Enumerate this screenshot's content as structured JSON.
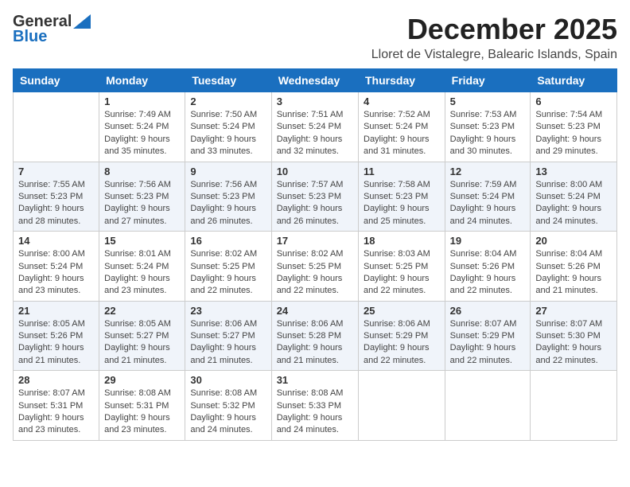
{
  "logo": {
    "general": "General",
    "blue": "Blue"
  },
  "title": "December 2025",
  "location": "Lloret de Vistalegre, Balearic Islands, Spain",
  "days_of_week": [
    "Sunday",
    "Monday",
    "Tuesday",
    "Wednesday",
    "Thursday",
    "Friday",
    "Saturday"
  ],
  "weeks": [
    [
      {
        "day": "",
        "sunrise": "",
        "sunset": "",
        "daylight": ""
      },
      {
        "day": "1",
        "sunrise": "Sunrise: 7:49 AM",
        "sunset": "Sunset: 5:24 PM",
        "daylight": "Daylight: 9 hours and 35 minutes."
      },
      {
        "day": "2",
        "sunrise": "Sunrise: 7:50 AM",
        "sunset": "Sunset: 5:24 PM",
        "daylight": "Daylight: 9 hours and 33 minutes."
      },
      {
        "day": "3",
        "sunrise": "Sunrise: 7:51 AM",
        "sunset": "Sunset: 5:24 PM",
        "daylight": "Daylight: 9 hours and 32 minutes."
      },
      {
        "day": "4",
        "sunrise": "Sunrise: 7:52 AM",
        "sunset": "Sunset: 5:24 PM",
        "daylight": "Daylight: 9 hours and 31 minutes."
      },
      {
        "day": "5",
        "sunrise": "Sunrise: 7:53 AM",
        "sunset": "Sunset: 5:23 PM",
        "daylight": "Daylight: 9 hours and 30 minutes."
      },
      {
        "day": "6",
        "sunrise": "Sunrise: 7:54 AM",
        "sunset": "Sunset: 5:23 PM",
        "daylight": "Daylight: 9 hours and 29 minutes."
      }
    ],
    [
      {
        "day": "7",
        "sunrise": "Sunrise: 7:55 AM",
        "sunset": "Sunset: 5:23 PM",
        "daylight": "Daylight: 9 hours and 28 minutes."
      },
      {
        "day": "8",
        "sunrise": "Sunrise: 7:56 AM",
        "sunset": "Sunset: 5:23 PM",
        "daylight": "Daylight: 9 hours and 27 minutes."
      },
      {
        "day": "9",
        "sunrise": "Sunrise: 7:56 AM",
        "sunset": "Sunset: 5:23 PM",
        "daylight": "Daylight: 9 hours and 26 minutes."
      },
      {
        "day": "10",
        "sunrise": "Sunrise: 7:57 AM",
        "sunset": "Sunset: 5:23 PM",
        "daylight": "Daylight: 9 hours and 26 minutes."
      },
      {
        "day": "11",
        "sunrise": "Sunrise: 7:58 AM",
        "sunset": "Sunset: 5:23 PM",
        "daylight": "Daylight: 9 hours and 25 minutes."
      },
      {
        "day": "12",
        "sunrise": "Sunrise: 7:59 AM",
        "sunset": "Sunset: 5:24 PM",
        "daylight": "Daylight: 9 hours and 24 minutes."
      },
      {
        "day": "13",
        "sunrise": "Sunrise: 8:00 AM",
        "sunset": "Sunset: 5:24 PM",
        "daylight": "Daylight: 9 hours and 24 minutes."
      }
    ],
    [
      {
        "day": "14",
        "sunrise": "Sunrise: 8:00 AM",
        "sunset": "Sunset: 5:24 PM",
        "daylight": "Daylight: 9 hours and 23 minutes."
      },
      {
        "day": "15",
        "sunrise": "Sunrise: 8:01 AM",
        "sunset": "Sunset: 5:24 PM",
        "daylight": "Daylight: 9 hours and 23 minutes."
      },
      {
        "day": "16",
        "sunrise": "Sunrise: 8:02 AM",
        "sunset": "Sunset: 5:25 PM",
        "daylight": "Daylight: 9 hours and 22 minutes."
      },
      {
        "day": "17",
        "sunrise": "Sunrise: 8:02 AM",
        "sunset": "Sunset: 5:25 PM",
        "daylight": "Daylight: 9 hours and 22 minutes."
      },
      {
        "day": "18",
        "sunrise": "Sunrise: 8:03 AM",
        "sunset": "Sunset: 5:25 PM",
        "daylight": "Daylight: 9 hours and 22 minutes."
      },
      {
        "day": "19",
        "sunrise": "Sunrise: 8:04 AM",
        "sunset": "Sunset: 5:26 PM",
        "daylight": "Daylight: 9 hours and 22 minutes."
      },
      {
        "day": "20",
        "sunrise": "Sunrise: 8:04 AM",
        "sunset": "Sunset: 5:26 PM",
        "daylight": "Daylight: 9 hours and 21 minutes."
      }
    ],
    [
      {
        "day": "21",
        "sunrise": "Sunrise: 8:05 AM",
        "sunset": "Sunset: 5:26 PM",
        "daylight": "Daylight: 9 hours and 21 minutes."
      },
      {
        "day": "22",
        "sunrise": "Sunrise: 8:05 AM",
        "sunset": "Sunset: 5:27 PM",
        "daylight": "Daylight: 9 hours and 21 minutes."
      },
      {
        "day": "23",
        "sunrise": "Sunrise: 8:06 AM",
        "sunset": "Sunset: 5:27 PM",
        "daylight": "Daylight: 9 hours and 21 minutes."
      },
      {
        "day": "24",
        "sunrise": "Sunrise: 8:06 AM",
        "sunset": "Sunset: 5:28 PM",
        "daylight": "Daylight: 9 hours and 21 minutes."
      },
      {
        "day": "25",
        "sunrise": "Sunrise: 8:06 AM",
        "sunset": "Sunset: 5:29 PM",
        "daylight": "Daylight: 9 hours and 22 minutes."
      },
      {
        "day": "26",
        "sunrise": "Sunrise: 8:07 AM",
        "sunset": "Sunset: 5:29 PM",
        "daylight": "Daylight: 9 hours and 22 minutes."
      },
      {
        "day": "27",
        "sunrise": "Sunrise: 8:07 AM",
        "sunset": "Sunset: 5:30 PM",
        "daylight": "Daylight: 9 hours and 22 minutes."
      }
    ],
    [
      {
        "day": "28",
        "sunrise": "Sunrise: 8:07 AM",
        "sunset": "Sunset: 5:31 PM",
        "daylight": "Daylight: 9 hours and 23 minutes."
      },
      {
        "day": "29",
        "sunrise": "Sunrise: 8:08 AM",
        "sunset": "Sunset: 5:31 PM",
        "daylight": "Daylight: 9 hours and 23 minutes."
      },
      {
        "day": "30",
        "sunrise": "Sunrise: 8:08 AM",
        "sunset": "Sunset: 5:32 PM",
        "daylight": "Daylight: 9 hours and 24 minutes."
      },
      {
        "day": "31",
        "sunrise": "Sunrise: 8:08 AM",
        "sunset": "Sunset: 5:33 PM",
        "daylight": "Daylight: 9 hours and 24 minutes."
      },
      {
        "day": "",
        "sunrise": "",
        "sunset": "",
        "daylight": ""
      },
      {
        "day": "",
        "sunrise": "",
        "sunset": "",
        "daylight": ""
      },
      {
        "day": "",
        "sunrise": "",
        "sunset": "",
        "daylight": ""
      }
    ]
  ]
}
